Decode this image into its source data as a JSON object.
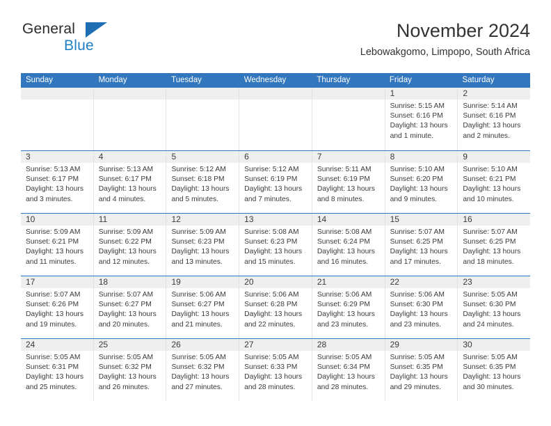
{
  "brand": {
    "name_part1": "General",
    "name_part2": "Blue",
    "triangle_icon": "triangle-icon",
    "colors": {
      "dark": "#2b2b2b",
      "blue": "#1f7ec4",
      "header_blue": "#3277bd"
    }
  },
  "header": {
    "title": "November 2024",
    "subtitle": "Lebowakgomo, Limpopo, South Africa"
  },
  "weekdays": [
    "Sunday",
    "Monday",
    "Tuesday",
    "Wednesday",
    "Thursday",
    "Friday",
    "Saturday"
  ],
  "weeks": [
    [
      {
        "day": "",
        "lines": []
      },
      {
        "day": "",
        "lines": []
      },
      {
        "day": "",
        "lines": []
      },
      {
        "day": "",
        "lines": []
      },
      {
        "day": "",
        "lines": []
      },
      {
        "day": "1",
        "lines": [
          "Sunrise: 5:15 AM",
          "Sunset: 6:16 PM",
          "Daylight: 13 hours",
          "and 1 minute."
        ]
      },
      {
        "day": "2",
        "lines": [
          "Sunrise: 5:14 AM",
          "Sunset: 6:16 PM",
          "Daylight: 13 hours",
          "and 2 minutes."
        ]
      }
    ],
    [
      {
        "day": "3",
        "lines": [
          "Sunrise: 5:13 AM",
          "Sunset: 6:17 PM",
          "Daylight: 13 hours",
          "and 3 minutes."
        ]
      },
      {
        "day": "4",
        "lines": [
          "Sunrise: 5:13 AM",
          "Sunset: 6:17 PM",
          "Daylight: 13 hours",
          "and 4 minutes."
        ]
      },
      {
        "day": "5",
        "lines": [
          "Sunrise: 5:12 AM",
          "Sunset: 6:18 PM",
          "Daylight: 13 hours",
          "and 5 minutes."
        ]
      },
      {
        "day": "6",
        "lines": [
          "Sunrise: 5:12 AM",
          "Sunset: 6:19 PM",
          "Daylight: 13 hours",
          "and 7 minutes."
        ]
      },
      {
        "day": "7",
        "lines": [
          "Sunrise: 5:11 AM",
          "Sunset: 6:19 PM",
          "Daylight: 13 hours",
          "and 8 minutes."
        ]
      },
      {
        "day": "8",
        "lines": [
          "Sunrise: 5:10 AM",
          "Sunset: 6:20 PM",
          "Daylight: 13 hours",
          "and 9 minutes."
        ]
      },
      {
        "day": "9",
        "lines": [
          "Sunrise: 5:10 AM",
          "Sunset: 6:21 PM",
          "Daylight: 13 hours",
          "and 10 minutes."
        ]
      }
    ],
    [
      {
        "day": "10",
        "lines": [
          "Sunrise: 5:09 AM",
          "Sunset: 6:21 PM",
          "Daylight: 13 hours",
          "and 11 minutes."
        ]
      },
      {
        "day": "11",
        "lines": [
          "Sunrise: 5:09 AM",
          "Sunset: 6:22 PM",
          "Daylight: 13 hours",
          "and 12 minutes."
        ]
      },
      {
        "day": "12",
        "lines": [
          "Sunrise: 5:09 AM",
          "Sunset: 6:23 PM",
          "Daylight: 13 hours",
          "and 13 minutes."
        ]
      },
      {
        "day": "13",
        "lines": [
          "Sunrise: 5:08 AM",
          "Sunset: 6:23 PM",
          "Daylight: 13 hours",
          "and 15 minutes."
        ]
      },
      {
        "day": "14",
        "lines": [
          "Sunrise: 5:08 AM",
          "Sunset: 6:24 PM",
          "Daylight: 13 hours",
          "and 16 minutes."
        ]
      },
      {
        "day": "15",
        "lines": [
          "Sunrise: 5:07 AM",
          "Sunset: 6:25 PM",
          "Daylight: 13 hours",
          "and 17 minutes."
        ]
      },
      {
        "day": "16",
        "lines": [
          "Sunrise: 5:07 AM",
          "Sunset: 6:25 PM",
          "Daylight: 13 hours",
          "and 18 minutes."
        ]
      }
    ],
    [
      {
        "day": "17",
        "lines": [
          "Sunrise: 5:07 AM",
          "Sunset: 6:26 PM",
          "Daylight: 13 hours",
          "and 19 minutes."
        ]
      },
      {
        "day": "18",
        "lines": [
          "Sunrise: 5:07 AM",
          "Sunset: 6:27 PM",
          "Daylight: 13 hours",
          "and 20 minutes."
        ]
      },
      {
        "day": "19",
        "lines": [
          "Sunrise: 5:06 AM",
          "Sunset: 6:27 PM",
          "Daylight: 13 hours",
          "and 21 minutes."
        ]
      },
      {
        "day": "20",
        "lines": [
          "Sunrise: 5:06 AM",
          "Sunset: 6:28 PM",
          "Daylight: 13 hours",
          "and 22 minutes."
        ]
      },
      {
        "day": "21",
        "lines": [
          "Sunrise: 5:06 AM",
          "Sunset: 6:29 PM",
          "Daylight: 13 hours",
          "and 23 minutes."
        ]
      },
      {
        "day": "22",
        "lines": [
          "Sunrise: 5:06 AM",
          "Sunset: 6:30 PM",
          "Daylight: 13 hours",
          "and 23 minutes."
        ]
      },
      {
        "day": "23",
        "lines": [
          "Sunrise: 5:05 AM",
          "Sunset: 6:30 PM",
          "Daylight: 13 hours",
          "and 24 minutes."
        ]
      }
    ],
    [
      {
        "day": "24",
        "lines": [
          "Sunrise: 5:05 AM",
          "Sunset: 6:31 PM",
          "Daylight: 13 hours",
          "and 25 minutes."
        ]
      },
      {
        "day": "25",
        "lines": [
          "Sunrise: 5:05 AM",
          "Sunset: 6:32 PM",
          "Daylight: 13 hours",
          "and 26 minutes."
        ]
      },
      {
        "day": "26",
        "lines": [
          "Sunrise: 5:05 AM",
          "Sunset: 6:32 PM",
          "Daylight: 13 hours",
          "and 27 minutes."
        ]
      },
      {
        "day": "27",
        "lines": [
          "Sunrise: 5:05 AM",
          "Sunset: 6:33 PM",
          "Daylight: 13 hours",
          "and 28 minutes."
        ]
      },
      {
        "day": "28",
        "lines": [
          "Sunrise: 5:05 AM",
          "Sunset: 6:34 PM",
          "Daylight: 13 hours",
          "and 28 minutes."
        ]
      },
      {
        "day": "29",
        "lines": [
          "Sunrise: 5:05 AM",
          "Sunset: 6:35 PM",
          "Daylight: 13 hours",
          "and 29 minutes."
        ]
      },
      {
        "day": "30",
        "lines": [
          "Sunrise: 5:05 AM",
          "Sunset: 6:35 PM",
          "Daylight: 13 hours",
          "and 30 minutes."
        ]
      }
    ]
  ]
}
